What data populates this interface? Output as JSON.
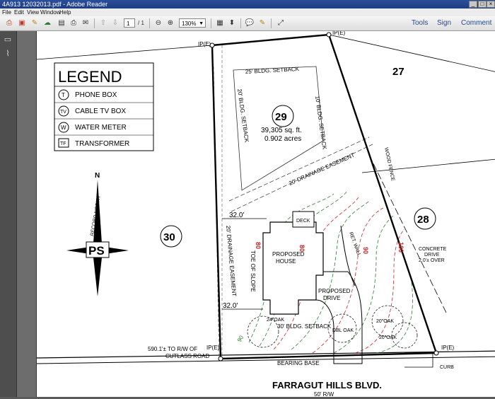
{
  "window": {
    "title": "4A913 12032013.pdf - Adobe Reader"
  },
  "menu": [
    "File",
    "Edit",
    "View",
    "Window",
    "Help"
  ],
  "toolbar": {
    "page_current": "1",
    "page_total": "/ 1",
    "zoom": "130%",
    "tools_label": "Tools",
    "sign_label": "Sign",
    "comment_label": "Comment"
  },
  "plan": {
    "legend": {
      "title": "LEGEND",
      "items": [
        {
          "symbol": "T",
          "label": "PHONE BOX"
        },
        {
          "symbol": "TV",
          "label": "CABLE TV BOX"
        },
        {
          "symbol": "W",
          "label": "WATER METER"
        },
        {
          "symbol": "TF",
          "label": "TRANSFORMER"
        }
      ]
    },
    "north": {
      "n": "N",
      "record": "RECORD NORTH",
      "logo": "PS"
    },
    "lots": [
      "27",
      "28",
      "29",
      "30"
    ],
    "lot_area": "39,305 sq. ft.",
    "lot_acres": "0.902 acres",
    "ip_label": "IP(E)",
    "setback_25": "25' BLDG. SETBACK",
    "setback_20": "20' BLDG. SETBACK",
    "setback_10": "10' BLDG. SETBACK",
    "setback_30": "30' BLDG. SETBACK",
    "drainage_20": "20' DRAINAGE EASEMENT",
    "drainage_20_v": "20' DRAINAGE EASEMENT",
    "wood_fence": "WOOD FENCE",
    "dim_32_top": "32.0'",
    "dim_32_bot": "32.0'",
    "deck": "DECK",
    "house": [
      "PROPOSED",
      "HOUSE"
    ],
    "drive": [
      "PROPOSED",
      "DRIVE"
    ],
    "toe_of_slope": "TOE OF SLOPE",
    "ret_wall": "RET. WALL",
    "concrete": [
      "CONCRETE",
      "DRIVE",
      "2.0'± OVER"
    ],
    "oak_24": "24\"OAK",
    "oak_dbl": "DBL OAK",
    "oak_20a": "20\"OAK",
    "oak_20b": "20\"OAK",
    "rw_note": [
      "590.1'± TO R/W OF",
      "CUTLASS ROAD"
    ],
    "bearing_base": "BEARING BASE",
    "curb": "CURB",
    "street": "FARRAGUT HILLS BLVD.",
    "row": "50' R/W",
    "contours": [
      "80",
      "80",
      "90",
      "100",
      "90"
    ]
  }
}
